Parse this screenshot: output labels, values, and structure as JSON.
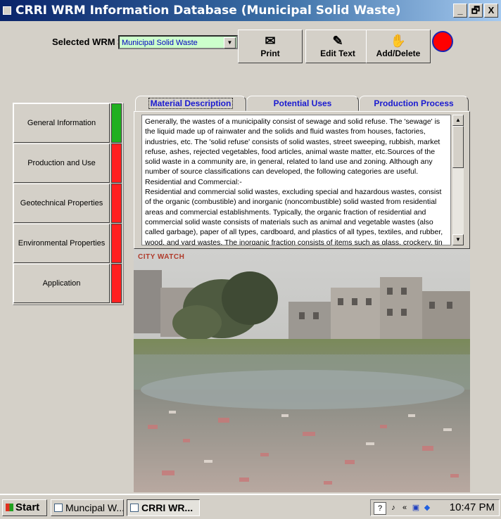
{
  "window": {
    "title": "CRRI WRM Information Database (Municipal Solid Waste)",
    "min_glyph": "_",
    "max_glyph": "🗗",
    "close_glyph": "X"
  },
  "toolbar": {
    "selected_label": "Selected  WRM >",
    "selected_value": "Municipal Solid Waste",
    "print_label": "Print",
    "edit_label": "Edit Text",
    "add_delete_label": "Add/Delete"
  },
  "colors": {
    "indicator_green": "#20b020",
    "indicator_red": "#ff2020",
    "status_dot": "#ff0000"
  },
  "nav": {
    "items": [
      {
        "label": "General Information",
        "status": "green"
      },
      {
        "label": "Production and Use",
        "status": "red"
      },
      {
        "label": "Geotechnical Properties",
        "status": "red"
      },
      {
        "label": "Environmental Properties",
        "status": "red"
      },
      {
        "label": "Application",
        "status": "red"
      }
    ]
  },
  "tabs": [
    {
      "label": "Material Description",
      "active": true
    },
    {
      "label": "Potential Uses",
      "active": false
    },
    {
      "label": "Production Process",
      "active": false
    }
  ],
  "description": {
    "para1": "Generally, the wastes of a municipality consist of sewage and solid refuse. The 'sewage' is the liquid made up of rainwater and the solids and fluid wastes from houses, factories, industries, etc. The 'solid refuse' consists of solid wastes, street sweeping, rubbish, market refuse, ashes, rejected vegetables, food articles, animal waste matter, etc.Sources of the solid waste in a community are, in general, related to land use and zoning. Although any number of source classifications can developed, the following categories are useful.",
    "para2": "Residential and Commercial:-",
    "para3": "Residential and commercial solid wastes, excluding special and hazardous wastes, consist of the organic (combustible) and inorganic (noncombustible) solid wasted from residential areas and commercial establishments. Typically, the organic fraction of residential and commercial solid waste consists of materials such as animal and vegetable wastes (also called garbage), paper of all types, cardboard, and plastics of all types, textiles, and rubber, wood, and yard wastes. The inorganic fraction consists of items such as glass, crockery, tin canes, aluminium, ferrous metal and ashes."
  },
  "photo": {
    "label": "CITY WATCH"
  },
  "taskbar": {
    "start_label": "Start",
    "task1": "Muncipal W...",
    "task2": "CRRI WR...",
    "clock": "10:47 PM"
  }
}
